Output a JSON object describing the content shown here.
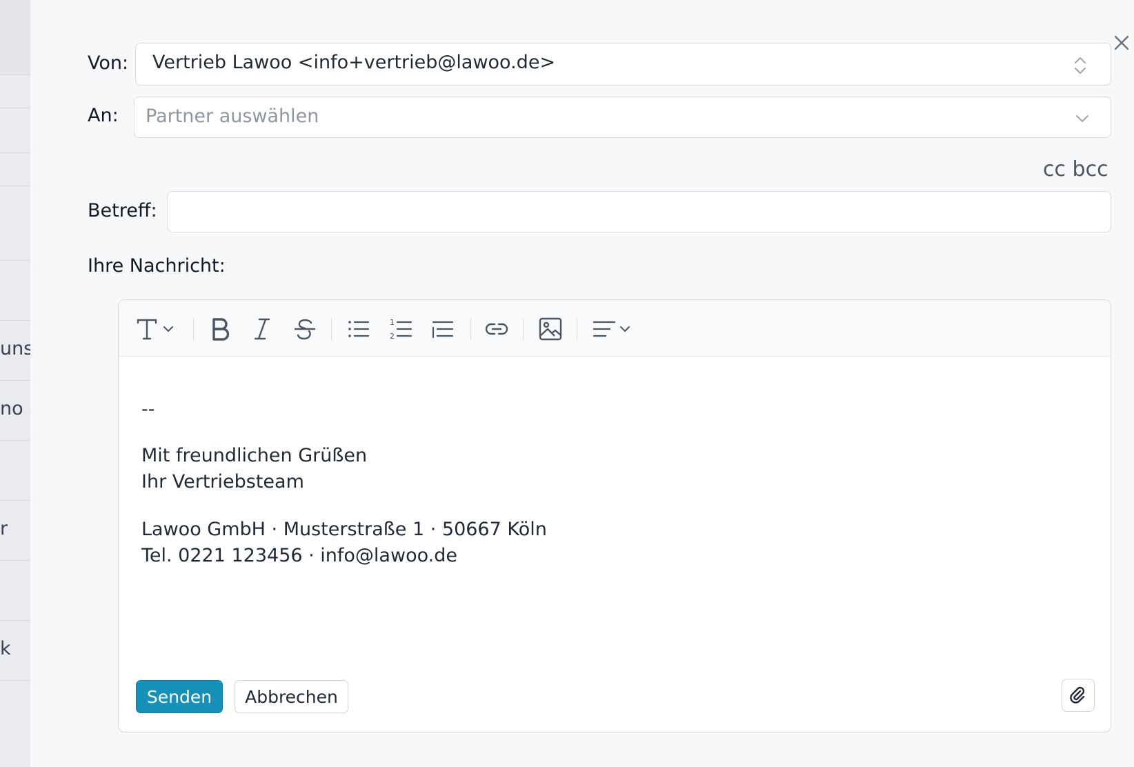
{
  "background": {
    "rows": [
      "",
      "",
      "",
      "",
      "",
      "uns",
      "no a",
      "",
      "r",
      "",
      "k"
    ]
  },
  "compose": {
    "from_label": "Von:",
    "from_value": "Vertrieb Lawoo <info+vertrieb@lawoo.de>",
    "to_label": "An:",
    "to_placeholder": "Partner auswählen",
    "cc_label": "cc",
    "bcc_label": "bcc",
    "subject_label": "Betreff:",
    "subject_value": "",
    "message_label": "Ihre Nachricht:",
    "body": {
      "separator": "--",
      "greeting": "Mit freundlichen Grüßen",
      "team": "Ihr Vertriebsteam",
      "company": "Lawoo GmbH · Musterstraße 1 · 50667 Köln",
      "contact": "Tel. 0221 123456 · info@lawoo.de"
    },
    "send_label": "Senden",
    "cancel_label": "Abbrechen"
  },
  "icons": {
    "close": "close-icon",
    "text_style": "text-type-icon",
    "bold": "bold-icon",
    "italic": "italic-icon",
    "strikethrough": "strikethrough-icon",
    "bullet_list": "bullet-list-icon",
    "numbered_list": "numbered-list-icon",
    "indent": "indent-icon",
    "link": "link-icon",
    "image": "image-icon",
    "align": "align-icon",
    "attach": "paperclip-icon"
  },
  "colors": {
    "primary": "#1590b8",
    "background": "#f7f8fa"
  }
}
